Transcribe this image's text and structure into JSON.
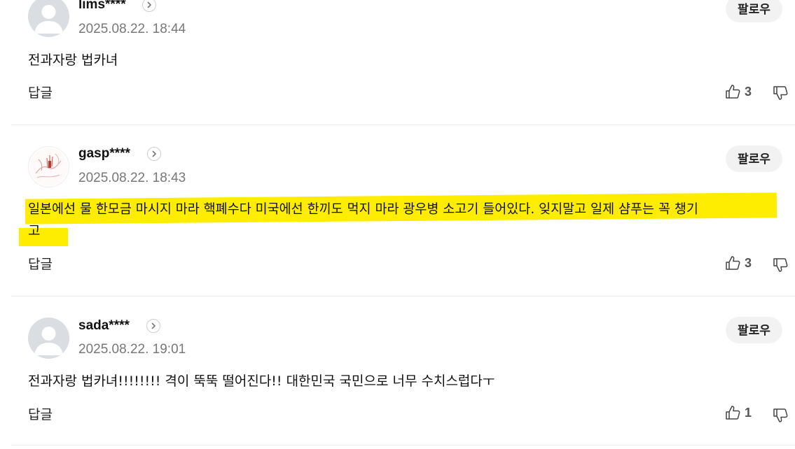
{
  "follow_label": "팔로우",
  "reply_label": "답글",
  "icons": {
    "profile_arrow": "chevron-right-icon",
    "like": "thumbs-up-icon",
    "dislike": "thumbs-down-icon",
    "avatar_default": "default-user-icon"
  },
  "colors": {
    "highlight": "#ffed00",
    "timestamp": "#777777",
    "follow_bg": "#f2f2f2"
  },
  "comments": [
    {
      "username": "lims****",
      "timestamp": "2025.08.22. 18:44",
      "text": "전과자랑 법카녀",
      "likes": "3",
      "avatar": "default"
    },
    {
      "username": "gasp****",
      "timestamp": "2025.08.22. 18:43",
      "text_line1": "일본에선 물 한모금 마시지 마라 핵폐수다 미국에선 한끼도 먹지 마라 광우병 소고기 들어있다. 잊지말고 일제 샴푸는 꼭 챙기",
      "text_line2": "고",
      "likes": "3",
      "avatar": "custom",
      "highlighted": true
    },
    {
      "username": "sada****",
      "timestamp": "2025.08.22. 19:01",
      "text": "전과자랑 법카녀!!!!!!!! 격이 뚝뚝 떨어진다!! 대한민국 국민으로 너무 수치스럽다ㅜ",
      "likes": "1",
      "avatar": "default"
    }
  ]
}
